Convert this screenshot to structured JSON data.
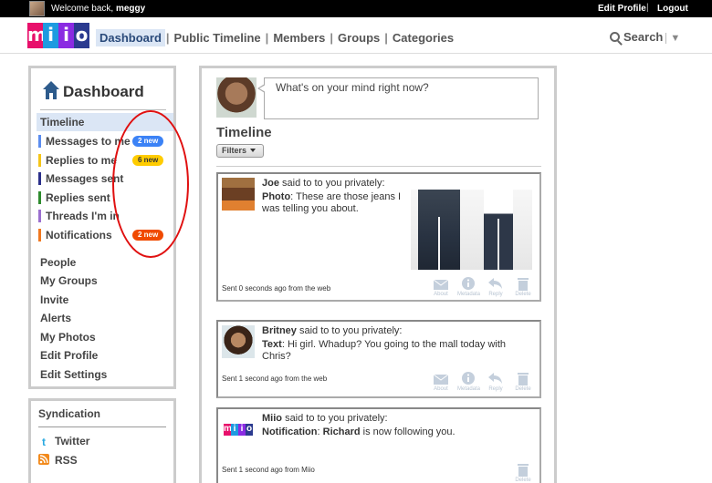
{
  "topbar": {
    "welcome_prefix": "Welcome back,",
    "username": "meggy",
    "edit_profile": "Edit Profile",
    "separator": "|",
    "logout": "Logout"
  },
  "logo": {
    "letters": [
      "m",
      "i",
      "i",
      "o"
    ],
    "colors": [
      "#e8106b",
      "#1e9be0",
      "#8a2be2",
      "#2b3a8f"
    ]
  },
  "nav": {
    "items": [
      "Dashboard",
      "Public Timeline",
      "Members",
      "Groups",
      "Categories"
    ],
    "active": "Dashboard",
    "search_label": "Search",
    "separator": "|"
  },
  "sidebar": {
    "title": "Dashboard",
    "items": [
      {
        "label": "Timeline",
        "active": true
      },
      {
        "label": "Messages to me",
        "bar_color": "#5b8def",
        "badge": "2 new",
        "badge_color": "#3b82f6"
      },
      {
        "label": "Replies to me",
        "bar_color": "#f5c518",
        "badge": "6 new",
        "badge_color": "#ffcc00"
      },
      {
        "label": "Messages sent",
        "bar_color": "#2b2f8a"
      },
      {
        "label": "Replies sent",
        "bar_color": "#2e8b2e"
      },
      {
        "label": "Threads I'm in",
        "bar_color": "#9b6fcf"
      },
      {
        "label": "Notifications",
        "bar_color": "#f07820",
        "badge": "2 new",
        "badge_color": "#f04a00"
      }
    ],
    "links": [
      "People",
      "My Groups",
      "Invite",
      "Alerts",
      "My Photos",
      "Edit Profile",
      "Edit Settings"
    ]
  },
  "syndication": {
    "title": "Syndication",
    "items": [
      {
        "label": "Twitter",
        "icon": "twitter-icon"
      },
      {
        "label": "RSS",
        "icon": "rss-icon"
      }
    ]
  },
  "composer": {
    "placeholder": "What's on your mind right now?"
  },
  "timeline": {
    "title": "Timeline",
    "filters_label": "Filters",
    "action_labels": [
      "About",
      "Metadata",
      "Reply",
      "Delete"
    ],
    "cards": [
      {
        "author": "Joe",
        "said": "said to to you privately:",
        "kind": "Photo",
        "text": "These are those jeans I was telling you about.",
        "sent": "Sent 0 seconds ago from the web"
      },
      {
        "author": "Britney",
        "said": "said to to you privately:",
        "kind": "Text",
        "text": "Hi girl. Whadup? You going to the mall today with Chris?",
        "sent": "Sent 1 second ago from the web"
      },
      {
        "author": "Miio",
        "said": "said to to you privately:",
        "kind": "Notification",
        "actor": "Richard",
        "text": "is now following you.",
        "sent": "Sent 1 second ago from Miio"
      }
    ]
  }
}
